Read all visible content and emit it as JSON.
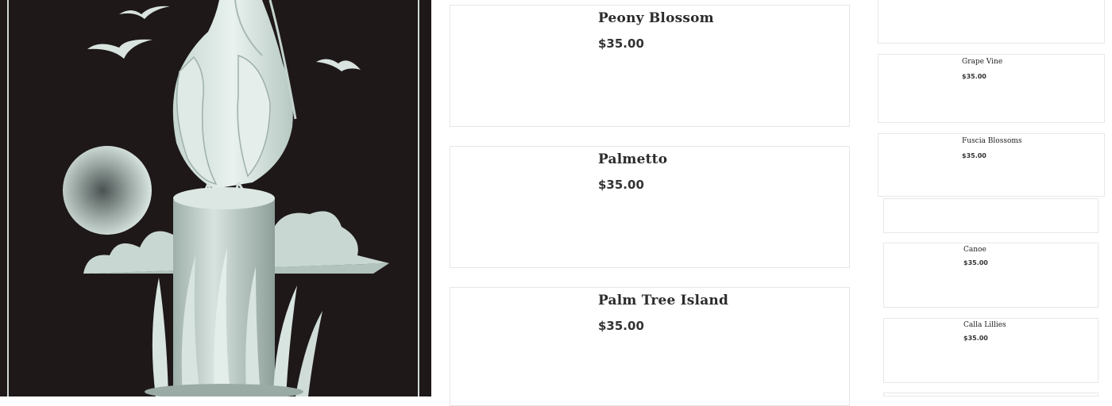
{
  "hero": {
    "icon": "etched-glass-pelican-image"
  },
  "products": [
    {
      "name": "Peony Blossom",
      "price": "$35.00"
    },
    {
      "name": "Palmetto",
      "price": "$35.00"
    },
    {
      "name": "Palm Tree Island",
      "price": "$35.00"
    }
  ],
  "sidebar": [
    {
      "name": "",
      "price": ""
    },
    {
      "name": "Grape Vine",
      "price": "$35.00"
    },
    {
      "name": "Fuscia Blossoms",
      "price": "$35.00"
    },
    {
      "name": "",
      "price": ""
    },
    {
      "name": "Canoe",
      "price": "$35.00"
    },
    {
      "name": "Calla Lillies",
      "price": "$35.00"
    },
    {
      "name": "",
      "price": ""
    }
  ]
}
